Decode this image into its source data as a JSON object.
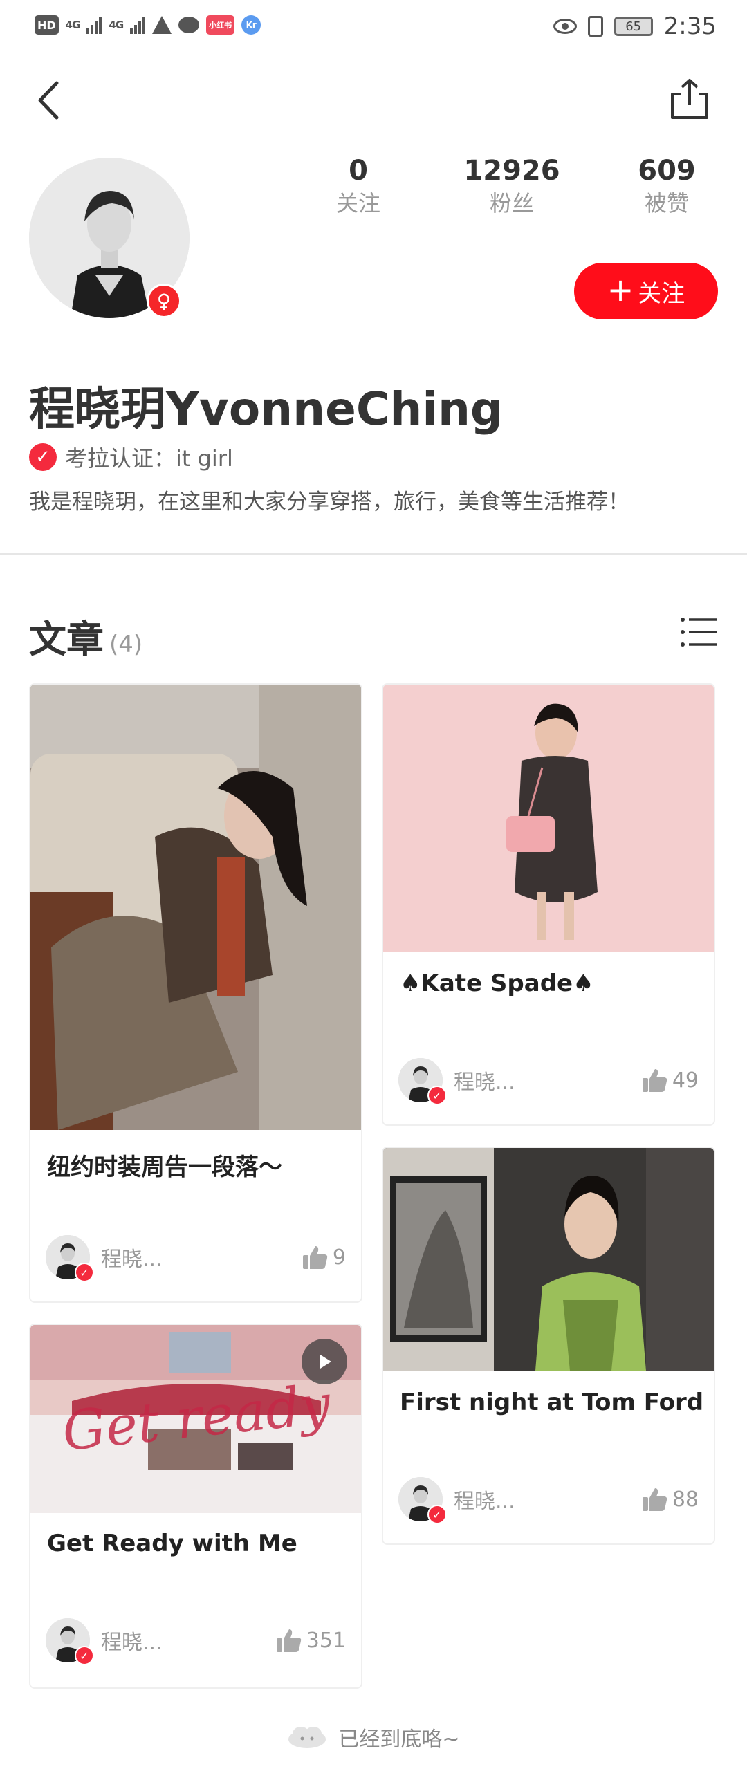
{
  "status_bar": {
    "hd": "HD",
    "net1": "4G",
    "net2": "4G",
    "app1": "小红书",
    "app2": "Kr",
    "battery": "65",
    "time": "2:35"
  },
  "profile": {
    "stats": [
      {
        "value": "0",
        "label": "关注"
      },
      {
        "value": "12926",
        "label": "粉丝"
      },
      {
        "value": "609",
        "label": "被赞"
      }
    ],
    "follow_label": "关注",
    "follow_plus": "+",
    "gender_icon": "♀",
    "name": "程晓玥YvonneChing",
    "verify_text": "考拉认证：it girl",
    "bio": "我是程晓玥，在这里和大家分享穿搭，旅行，美食等生活推荐！"
  },
  "section": {
    "title": "文章",
    "count": "(4)"
  },
  "articles": [
    {
      "title": "纽约时装周告一段落～",
      "author": "程晓...",
      "likes": "9"
    },
    {
      "title": "♠Kate Spade♠",
      "author": "程晓...",
      "likes": "49"
    },
    {
      "title": "First night at Tom Ford",
      "author": "程晓...",
      "likes": "88"
    },
    {
      "title": "Get Ready with Me",
      "author": "程晓...",
      "likes": "351",
      "overlay_text": "Get ready"
    }
  ],
  "footer": {
    "text": "已经到底咯~"
  },
  "colors": {
    "accent": "#ff0d1a",
    "verify": "#f42a3d"
  }
}
